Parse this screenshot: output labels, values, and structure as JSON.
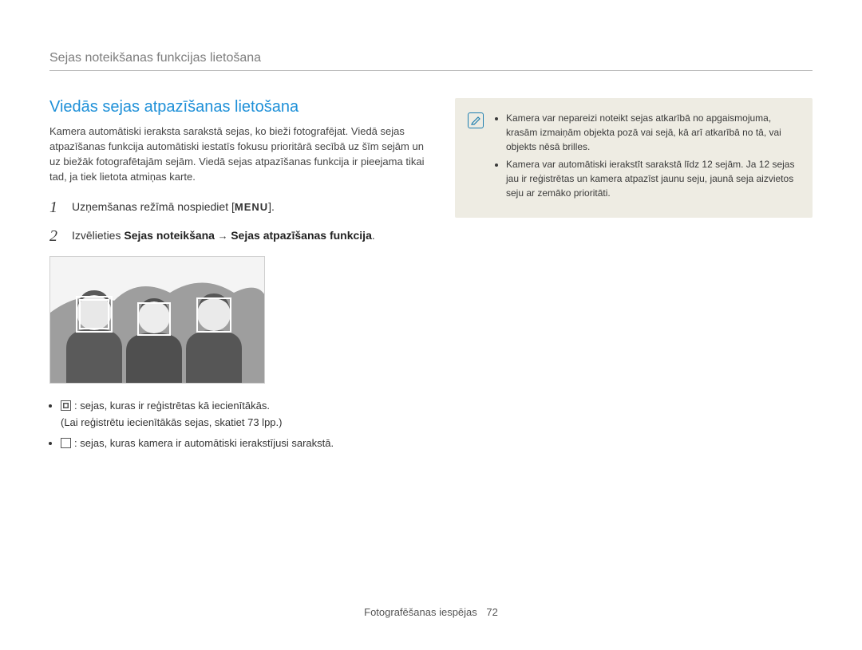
{
  "header": {
    "title": "Sejas noteikšanas funkcijas lietošana"
  },
  "section": {
    "title": "Viedās sejas atpazīšanas lietošana",
    "intro": "Kamera automātiski ieraksta sarakstā sejas, ko bieži fotografējat. Viedā sejas atpazīšanas funkcija automātiski iestatīs fokusu prioritārā secībā uz šīm sejām un uz biežāk fotografētajām sejām. Viedā sejas atpazīšanas funkcija ir pieejama tikai tad, ja tiek lietota atmiņas karte."
  },
  "steps": [
    {
      "num": "1",
      "text_before": "Uzņemšanas režīmā nospiediet [",
      "menu": "MENU",
      "text_after": "]."
    },
    {
      "num": "2",
      "text_lead": "Izvēlieties ",
      "bold_a": "Sejas noteikšana",
      "arrow": " → ",
      "bold_b": "Sejas atpazīšanas funkcija",
      "trail": "."
    }
  ],
  "bullets": [
    {
      "text": ": sejas, kuras ir reģistrētas kā iecienītākās.",
      "sub": "(Lai reģistrētu iecienītākās sejas, skatiet 73 lpp.)"
    },
    {
      "text": ": sejas, kuras kamera ir automātiski ierakstījusi sarakstā.",
      "sub": ""
    }
  ],
  "notes": [
    "Kamera var nepareizi noteikt sejas atkarībā no apgaismojuma, krasām izmaiņām objekta pozā vai sejā, kā arī atkarībā no tā, vai objekts nēsā brilles.",
    "Kamera var automātiski ierakstīt sarakstā līdz 12 sejām. Ja 12 sejas jau ir reģistrētas un kamera atpazīst jaunu seju, jaunā seja aizvietos seju ar zemāko prioritāti."
  ],
  "footer": {
    "label": "Fotografēšanas iespējas",
    "page": "72"
  }
}
